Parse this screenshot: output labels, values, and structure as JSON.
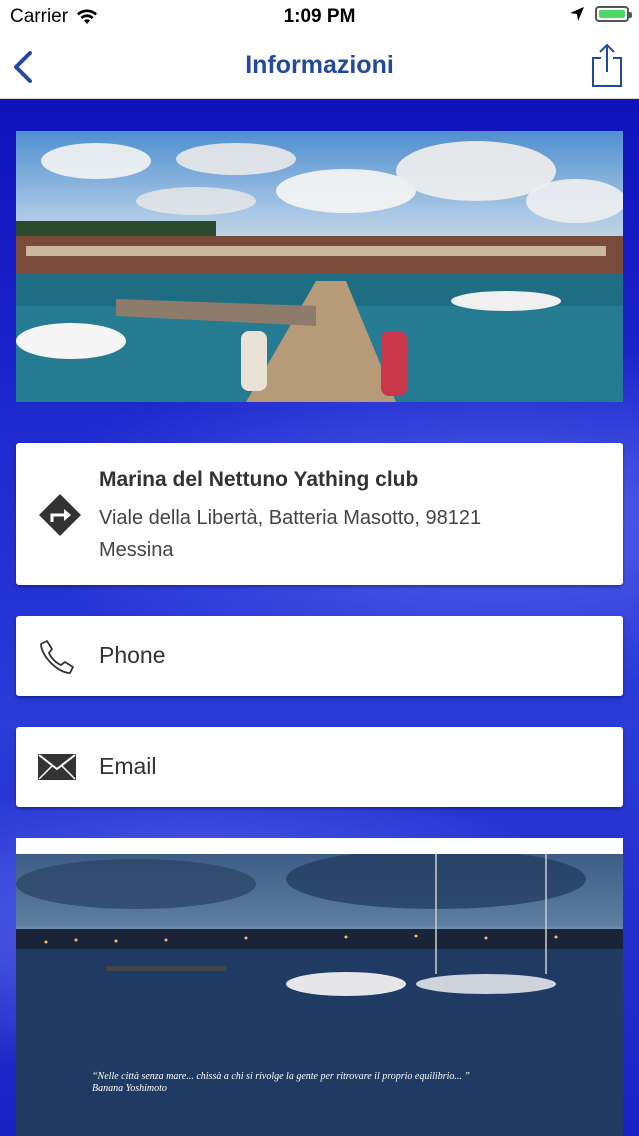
{
  "status_bar": {
    "carrier": "Carrier",
    "time": "1:09 PM"
  },
  "nav": {
    "title": "Informazioni",
    "back_icon": "chevron-left-icon",
    "share_icon": "share-icon",
    "accent_color": "#234a9b"
  },
  "address_card": {
    "icon": "directions-icon",
    "name": "Marina del Nettuno Yathing club",
    "line1": "Viale della Libertà, Batteria Masotto, 98121",
    "line2": "Messina"
  },
  "phone_card": {
    "icon": "phone-icon",
    "label": "Phone"
  },
  "email_card": {
    "icon": "envelope-icon",
    "label": "Email"
  },
  "bottom_photo": {
    "quote": "“Nelle città senza mare... chissà a chi si rivolge la gente per ritrovare il proprio equilibrio... ”",
    "author": "Banana Yoshimoto"
  },
  "colors": {
    "background": "#1d21c6",
    "card": "#ffffff"
  }
}
